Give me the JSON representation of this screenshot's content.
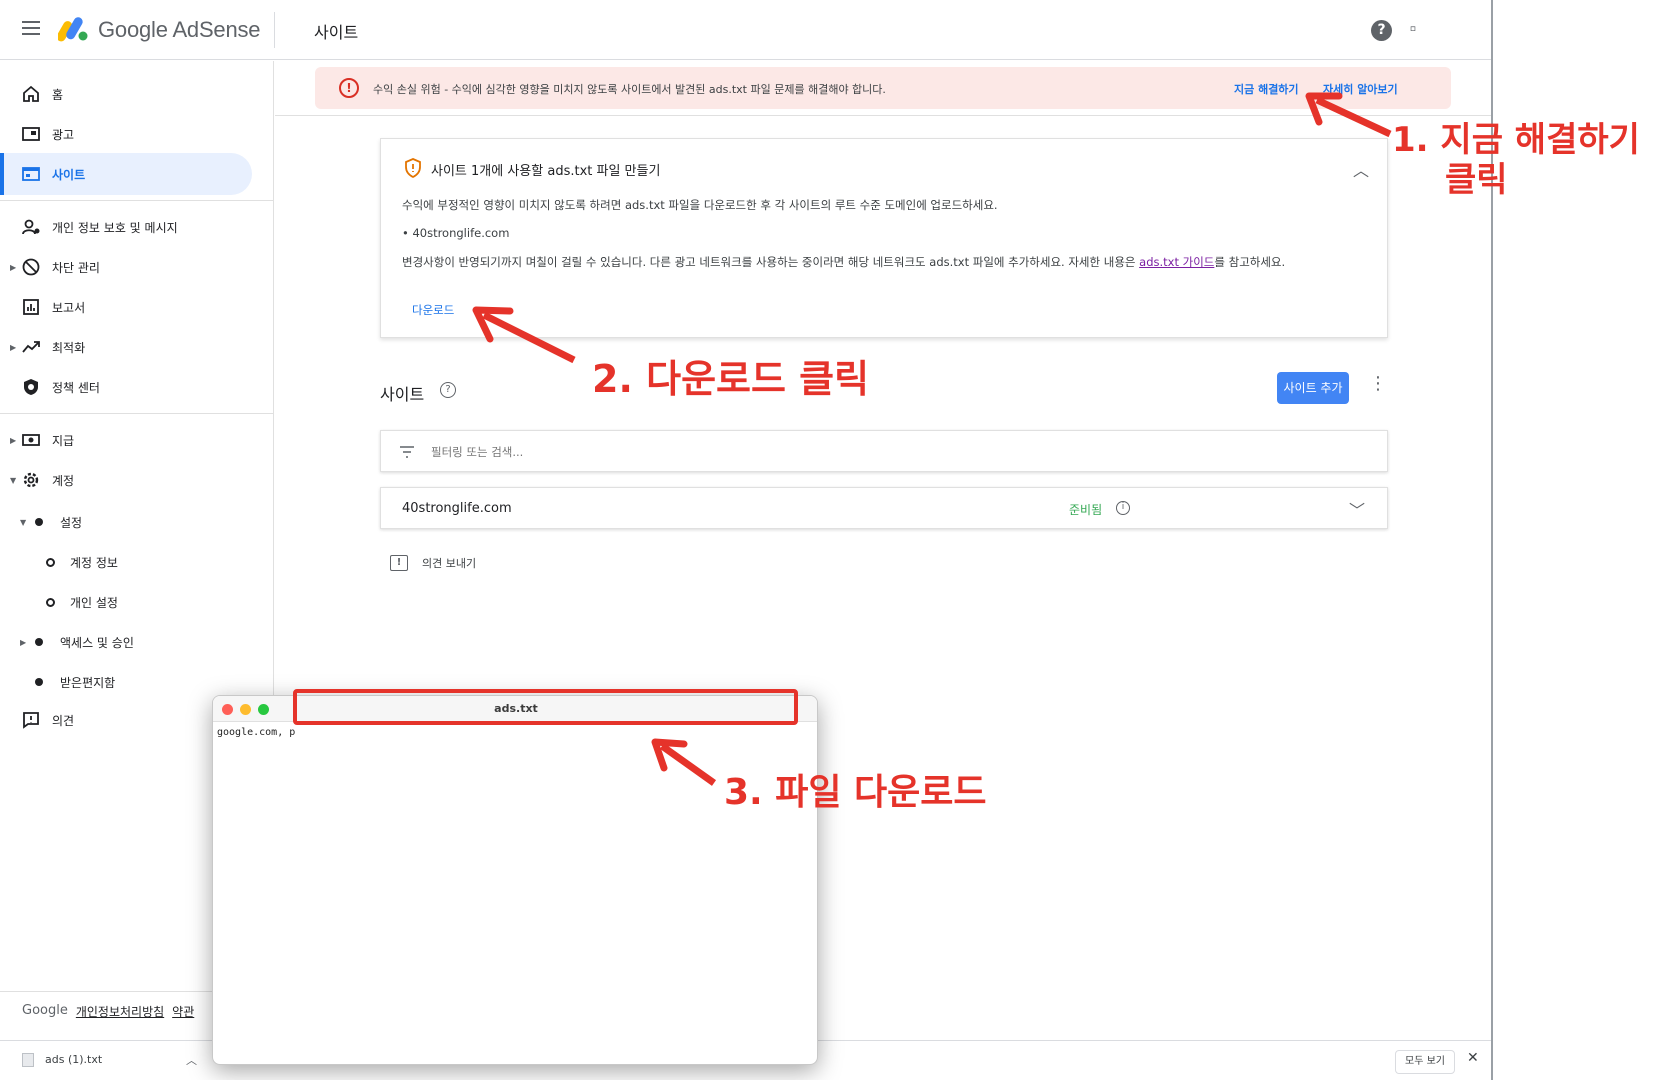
{
  "app": {
    "brand": "Google AdSense",
    "page_title": "사이트"
  },
  "sidebar": {
    "items": [
      {
        "label": "홈",
        "icon": "home-icon"
      },
      {
        "label": "광고",
        "icon": "ads-icon"
      },
      {
        "label": "사이트",
        "icon": "sites-icon",
        "active": true
      },
      {
        "label": "개인 정보 보호 및 메시지",
        "icon": "privacy-icon"
      },
      {
        "label": "차단 관리",
        "icon": "block-icon"
      },
      {
        "label": "보고서",
        "icon": "reports-icon"
      },
      {
        "label": "최적화",
        "icon": "optimization-icon"
      },
      {
        "label": "정책 센터",
        "icon": "policy-icon"
      },
      {
        "label": "지급",
        "icon": "payments-icon"
      },
      {
        "label": "계정",
        "icon": "gear-icon"
      }
    ],
    "account_sub": {
      "settings": "설정",
      "account_info": "계정 정보",
      "personal_settings": "개인 설정",
      "access": "액세스 및 승인",
      "inbox": "받은편지함"
    },
    "feedback": "의견",
    "footer": {
      "brand": "Google",
      "privacy": "개인정보처리방침",
      "terms": "약관"
    }
  },
  "alert": {
    "text": "수익 손실 위험 - 수익에 심각한 영향을 미치지 않도록 사이트에서 발견된 ads.txt 파일 문제를 해결해야 합니다.",
    "fix_now": "지금 해결하기",
    "learn_more": "자세히 알아보기"
  },
  "card": {
    "title": "사이트 1개에 사용할 ads.txt 파일 만들기",
    "description": "수익에 부정적인 영향이 미치지 않도록 하려면 ads.txt 파일을 다운로드한 후 각 사이트의 루트 수준 도메인에 업로드하세요.",
    "site_bullet": "40stronglife.com",
    "note_before": "변경사항이 반영되기까지 며칠이 걸릴 수 있습니다. 다른 광고 네트워크를 사용하는 중이라면 해당 네트워크도 ads.txt 파일에 추가하세요. 자세한 내용은 ",
    "note_link": "ads.txt 가이드",
    "note_after": "를 참고하세요.",
    "download": "다운로드"
  },
  "sites": {
    "heading": "사이트",
    "add_button": "사이트 추가",
    "filter_placeholder": "필터링 또는 검색...",
    "rows": [
      {
        "name": "40stronglife.com",
        "status": "준비됨"
      }
    ],
    "feedback": "의견 보내기"
  },
  "download_bar": {
    "file": "ads (1).txt",
    "show_all": "모두 보기"
  },
  "file_window": {
    "title": "ads.txt",
    "content": "google.com, p"
  },
  "annotations": {
    "step1_line1": "1.   지금 해결하기",
    "step1_line2": "클릭",
    "step2": "2. 다운로드 클릭",
    "step3": "3. 파일 다운로드"
  },
  "colors": {
    "accent": "#1a73e8",
    "alert_bg": "#fce8e6",
    "annotation": "#e5332a",
    "ready_status": "#34a853"
  }
}
